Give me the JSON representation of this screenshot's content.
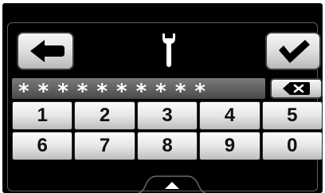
{
  "header": {
    "back_icon": "arrow-left-icon",
    "settings_icon": "wrench-icon",
    "confirm_icon": "checkmark-icon"
  },
  "password": {
    "masked_value": "**********",
    "delete_icon": "backspace-x-icon"
  },
  "keypad": {
    "keys": [
      "1",
      "2",
      "3",
      "4",
      "5",
      "6",
      "7",
      "8",
      "9",
      "0"
    ]
  },
  "footer": {
    "expand_icon": "up-triangle-icon"
  },
  "colors": {
    "background": "#000000",
    "button_light": "#f6f6f6",
    "button_dark": "#b9b9b9",
    "field": "#5a5a5a",
    "icon": "#000000"
  }
}
